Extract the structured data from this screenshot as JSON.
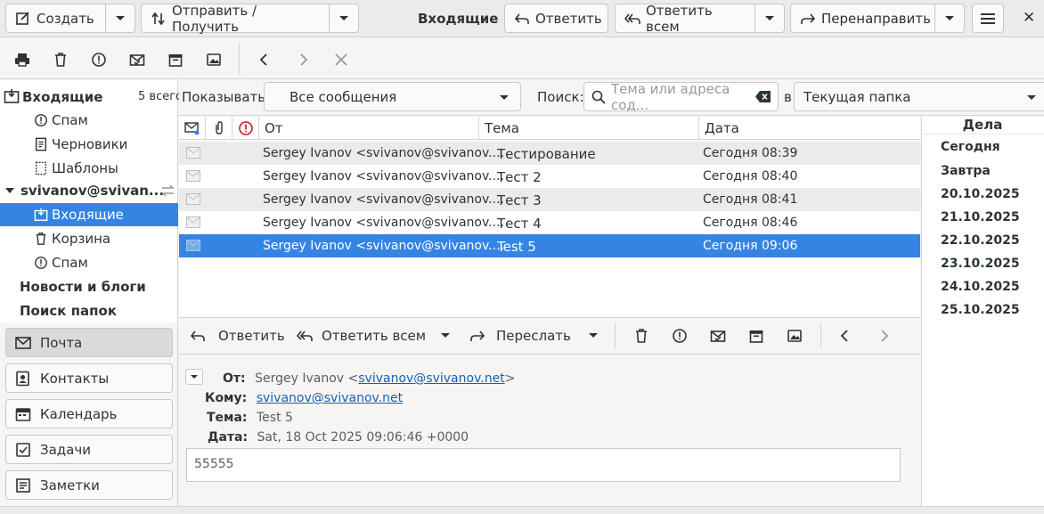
{
  "toolbar": {
    "create_label": "Создать",
    "send_receive_label": "Отправить / Получить",
    "folder_title": "Входящие",
    "reply_label": "Ответить",
    "reply_all_label": "Ответить всем",
    "forward_label": "Перенаправить",
    "close_glyph": "✕"
  },
  "sidebar": {
    "header_title": "Входящие",
    "header_count": "5 всего",
    "items": [
      {
        "label": "Спам"
      },
      {
        "label": "Черновики"
      },
      {
        "label": "Шаблоны"
      },
      {
        "label": "svivanov@svivan..."
      },
      {
        "label": "Входящие"
      },
      {
        "label": "Корзина"
      },
      {
        "label": "Спам"
      },
      {
        "label": "Новости и блоги"
      },
      {
        "label": "Поиск папок"
      }
    ],
    "nav": [
      "Почта",
      "Контакты",
      "Календарь",
      "Задачи",
      "Заметки"
    ]
  },
  "filter": {
    "show_label": "Показывать:",
    "show_value": "Все сообщения",
    "search_label": "Поиск:",
    "search_placeholder": "Тема или адреса сод...",
    "in_label": "в",
    "scope_value": "Текущая папка"
  },
  "list": {
    "columns": {
      "from": "От",
      "subject": "Тема",
      "date": "Дата"
    },
    "rows": [
      {
        "from": "Sergey Ivanov <svivanov@svivanov....",
        "subject": "Тестирование",
        "date": "Сегодня 08:39"
      },
      {
        "from": "Sergey Ivanov <svivanov@svivanov....",
        "subject": "Тест 2",
        "date": "Сегодня 08:40"
      },
      {
        "from": "Sergey Ivanov <svivanov@svivanov....",
        "subject": "Тест 3",
        "date": "Сегодня 08:41"
      },
      {
        "from": "Sergey Ivanov <svivanov@svivanov....",
        "subject": "Тест 4",
        "date": "Сегодня 08:46"
      },
      {
        "from": "Sergey Ivanov <svivanov@svivanov....",
        "subject": "Test 5",
        "date": "Сегодня 09:06"
      }
    ]
  },
  "preview": {
    "reply_label": "Ответить",
    "reply_all_label": "Ответить всем",
    "forward_label": "Переслать",
    "from_label": "От:",
    "from_name": "Sergey Ivanov <",
    "from_email": "svivanov@svivanov.net",
    "from_close": ">",
    "to_label": "Кому:",
    "to_email": "svivanov@svivanov.net",
    "subject_label": "Тема:",
    "subject_value": "Test 5",
    "date_label": "Дата:",
    "date_value": "Sat, 18 Oct 2025 09:06:46 +0000",
    "body": "55555"
  },
  "tasks": {
    "title": "Дела",
    "items": [
      "Сегодня",
      "Завтра",
      "20.10.2025",
      "21.10.2025",
      "22.10.2025",
      "23.10.2025",
      "24.10.2025",
      "25.10.2025"
    ]
  },
  "colors": {
    "accent": "#3584e4",
    "link": "#1a5fb4"
  }
}
